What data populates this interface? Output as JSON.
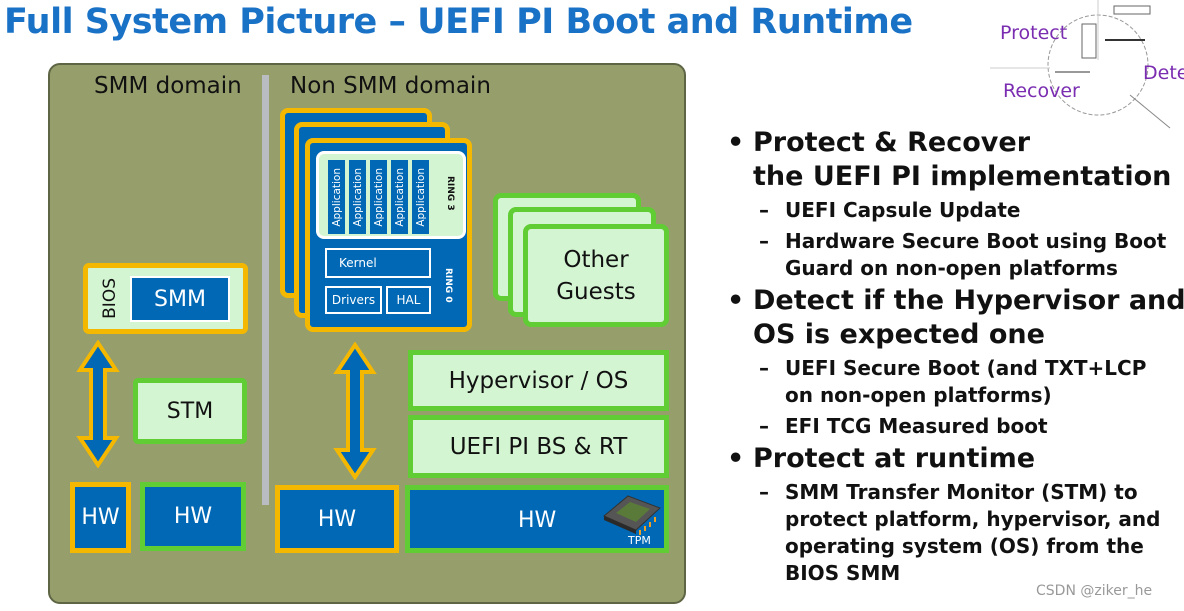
{
  "title": "Full System Picture – UEFI PI Boot and Runtime",
  "diagram": {
    "smm_domain": "SMM domain",
    "non_smm_domain": "Non SMM domain",
    "bios": "BIOS",
    "smm": "SMM",
    "stm": "STM",
    "hw": "HW",
    "applications": [
      "Application",
      "Application",
      "Application",
      "Application",
      "Application"
    ],
    "ring3": "RING 3",
    "ring0": "RING 0",
    "kernel": "Kernel",
    "drivers": "Drivers",
    "hal": "HAL",
    "other_guests": "Other Guests",
    "hypervisor": "Hypervisor / OS",
    "uefi": "UEFI PI BS & RT",
    "tpm": "TPM"
  },
  "corner": {
    "protect": "Protect",
    "detect": "Dete",
    "recover": "Recover"
  },
  "bullets": [
    {
      "text1": "Protect & Recover",
      "text2": "the UEFI PI implementation",
      "subs": [
        "UEFI Capsule Update",
        "Hardware Secure Boot using Boot",
        "Guard on non-open platforms"
      ]
    },
    {
      "text1": "Detect if the Hypervisor and",
      "text2": "OS is expected one",
      "subs": [
        "UEFI Secure Boot (and TXT+LCP",
        "on non-open platforms)",
        "EFI TCG Measured boot"
      ]
    },
    {
      "text1": "Protect at runtime",
      "subs": [
        "SMM Transfer Monitor (STM) to",
        "protect platform, hypervisor, and",
        "operating system (OS) from the",
        "BIOS SMM"
      ]
    }
  ],
  "watermark": "CSDN @ziker_he",
  "colors": {
    "title": "#1a72c6",
    "panel": "#969f6c",
    "blue": "#0068b5",
    "yellow": "#f5b800",
    "green": "#5fcd33",
    "light_green": "#d4f5d2"
  }
}
